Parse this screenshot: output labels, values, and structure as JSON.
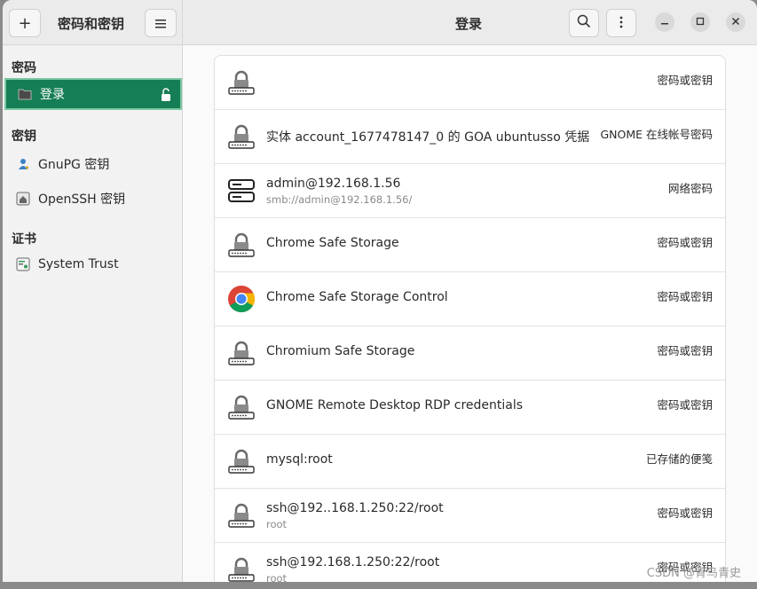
{
  "header": {
    "app_title": "密码和密钥",
    "page_title": "登录",
    "add_icon": "plus-icon",
    "menu_icon": "hamburger-icon",
    "search_icon": "search-icon",
    "more_icon": "vertical-dots-icon"
  },
  "sidebar": {
    "sections": [
      {
        "title": "密码"
      },
      {
        "title": "密钥"
      },
      {
        "title": "证书"
      }
    ],
    "items": [
      {
        "label": "登录",
        "icon": "folder-icon"
      },
      {
        "label": "GnuPG 密钥",
        "icon": "person-key-icon"
      },
      {
        "label": "OpenSSH 密钥",
        "icon": "home-key-icon"
      },
      {
        "label": "System Trust",
        "icon": "certificate-icon"
      }
    ]
  },
  "list": {
    "rows": [
      {
        "name": "",
        "sub": "",
        "kind": "密码或密钥",
        "icon": "lock-icon"
      },
      {
        "name": "实体 account_1677478147_0 的 GOA ubuntusso 凭据",
        "sub": "",
        "kind": "GNOME 在线帐号密码",
        "icon": "lock-icon"
      },
      {
        "name": "admin@192.168.1.56",
        "sub": "smb://admin@192.168.1.56/",
        "kind": "网络密码",
        "icon": "server-icon"
      },
      {
        "name": "Chrome Safe Storage",
        "sub": "",
        "kind": "密码或密钥",
        "icon": "lock-icon"
      },
      {
        "name": "Chrome Safe Storage Control",
        "sub": "",
        "kind": "密码或密钥",
        "icon": "chrome-icon"
      },
      {
        "name": "Chromium Safe Storage",
        "sub": "",
        "kind": "密码或密钥",
        "icon": "lock-icon"
      },
      {
        "name": "GNOME Remote Desktop RDP credentials",
        "sub": "",
        "kind": "密码或密钥",
        "icon": "lock-icon"
      },
      {
        "name": "mysql:root",
        "sub": "",
        "kind": "已存储的便笺",
        "icon": "lock-icon"
      },
      {
        "name": "ssh@192..168.1.250:22/root",
        "sub": "root",
        "kind": "密码或密钥",
        "icon": "lock-icon"
      },
      {
        "name": "ssh@192.168.1.250:22/root",
        "sub": "root",
        "kind": "密码或密钥",
        "icon": "lock-icon"
      }
    ]
  },
  "watermark": "CSDN @青鸟青史"
}
